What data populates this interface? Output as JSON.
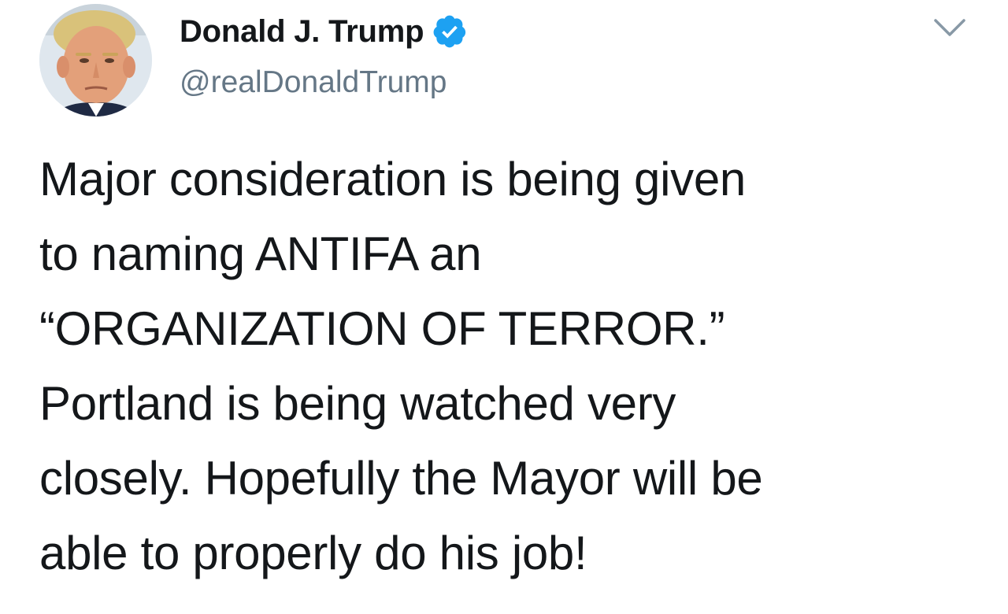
{
  "author": {
    "display_name": "Donald J. Trump",
    "handle": "@realDonaldTrump",
    "verified": true,
    "avatar_icon": "profile-photo",
    "verified_icon": "verified-badge-icon"
  },
  "menu": {
    "icon": "chevron-down-icon"
  },
  "tweet": {
    "text": "Major consideration is being given\nto naming ANTIFA an\n“ORGANIZATION OF TERROR.”\nPortland is being watched very\nclosely. Hopefully the Mayor will be\nable to properly do his job!"
  },
  "colors": {
    "text": "#14171a",
    "handle": "#657786",
    "verified": "#1da1f2",
    "background": "#ffffff"
  }
}
